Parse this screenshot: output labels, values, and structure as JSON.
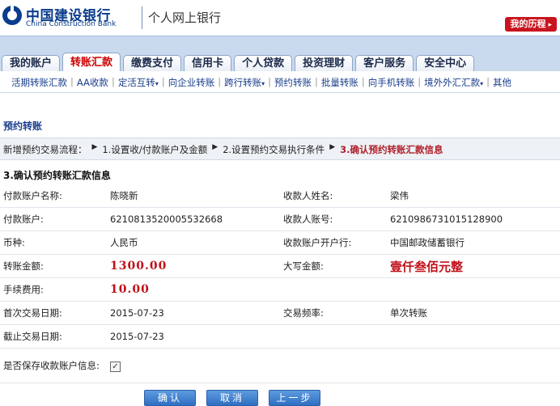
{
  "header": {
    "bank_name_cn": "中国建设银行",
    "bank_name_en": "China Construction Bank",
    "product_name": "个人网上银行",
    "history_button": "我的历程",
    "history_arrow": "▸"
  },
  "main_nav": {
    "tabs": [
      {
        "label": "我的账户"
      },
      {
        "label": "转账汇款"
      },
      {
        "label": "缴费支付"
      },
      {
        "label": "信用卡"
      },
      {
        "label": "个人贷款"
      },
      {
        "label": "投资理财"
      },
      {
        "label": "客户服务"
      },
      {
        "label": "安全中心"
      }
    ],
    "active": "转账汇款"
  },
  "sub_nav": {
    "items": [
      {
        "label": "活期转账汇款"
      },
      {
        "label": "AA收款"
      },
      {
        "label": "定活互转"
      },
      {
        "label": "向企业转账"
      },
      {
        "label": "跨行转账"
      },
      {
        "label": "预约转账"
      },
      {
        "label": "批量转账"
      },
      {
        "label": "向手机转账"
      },
      {
        "label": "境外外汇汇款"
      },
      {
        "label": "其他"
      }
    ],
    "dropdown_marker": "▾",
    "separator": "|",
    "active": "预约转账"
  },
  "page": {
    "title": "预约转账",
    "steps_prefix": "新增预约交易流程：",
    "step_arrow": "▶",
    "steps": [
      "1.设置收/付款账户及金额",
      "2.设置预约交易执行条件",
      "3.确认预约转账汇款信息"
    ],
    "section_title": "3.确认预约转账汇款信息"
  },
  "form": {
    "payer_name_label": "付款账户名称:",
    "payer_name": "陈晓新",
    "payee_name_label": "收款人姓名:",
    "payee_name": "梁伟",
    "payer_account_label": "付款账户:",
    "payer_account": "6210813520005532668",
    "payee_account_label": "收款人账号:",
    "payee_account": "6210986731015128900",
    "currency_label": "币种:",
    "currency": "人民币",
    "payee_bank_label": "收款账户开户行:",
    "payee_bank": "中国邮政储蓄银行",
    "amount_label": "转账金额:",
    "amount": "1300.00",
    "amount_cn_label": "大写金额:",
    "amount_cn": "壹仟叁佰元整",
    "fee_label": "手续费用:",
    "fee": "10.00",
    "first_date_label": "首次交易日期:",
    "first_date": "2015-07-23",
    "frequency_label": "交易频率:",
    "frequency": "单次转账",
    "end_date_label": "截止交易日期:",
    "end_date": "2015-07-23",
    "save_payee_label": "是否保存收款账户信息:",
    "save_payee_checked": true,
    "check_mark": "✓"
  },
  "buttons": {
    "confirm": "确认",
    "cancel": "取消",
    "back": "上一步"
  },
  "colors": {
    "brand_blue": "#0a3c8c",
    "nav_bg": "#c9d9ee",
    "accent_red": "#c0101a",
    "button_blue": "#2f6fc2"
  }
}
